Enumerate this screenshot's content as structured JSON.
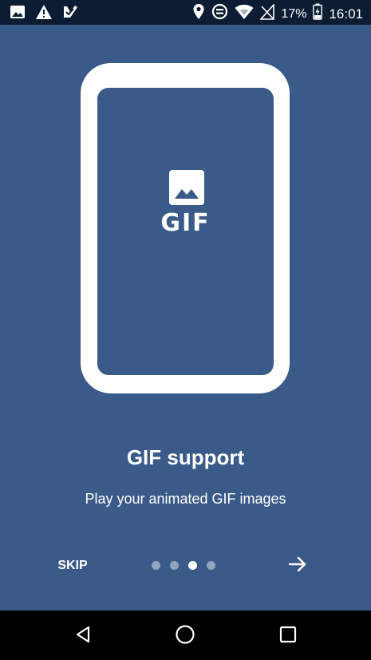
{
  "status_bar": {
    "battery_percent": "17%",
    "time": "16:01",
    "left_icons": [
      "image-icon",
      "warning-icon",
      "check-badge-icon"
    ],
    "right_icons": [
      "location-pin-icon",
      "data-saver-icon",
      "wifi-icon",
      "signal-icon",
      "battery-charging-icon"
    ]
  },
  "onboarding": {
    "illustration_label": "GIF",
    "title": "GIF support",
    "subtitle": "Play your animated GIF images",
    "skip_label": "SKIP",
    "page_count": 4,
    "active_page": 3
  },
  "nav_bar": {
    "icons": [
      "back-icon",
      "home-icon",
      "recents-icon"
    ]
  },
  "colors": {
    "background": "#3a5a89",
    "status_bar": "#0b1c33",
    "nav_bar": "#000000",
    "foreground": "#ffffff"
  }
}
